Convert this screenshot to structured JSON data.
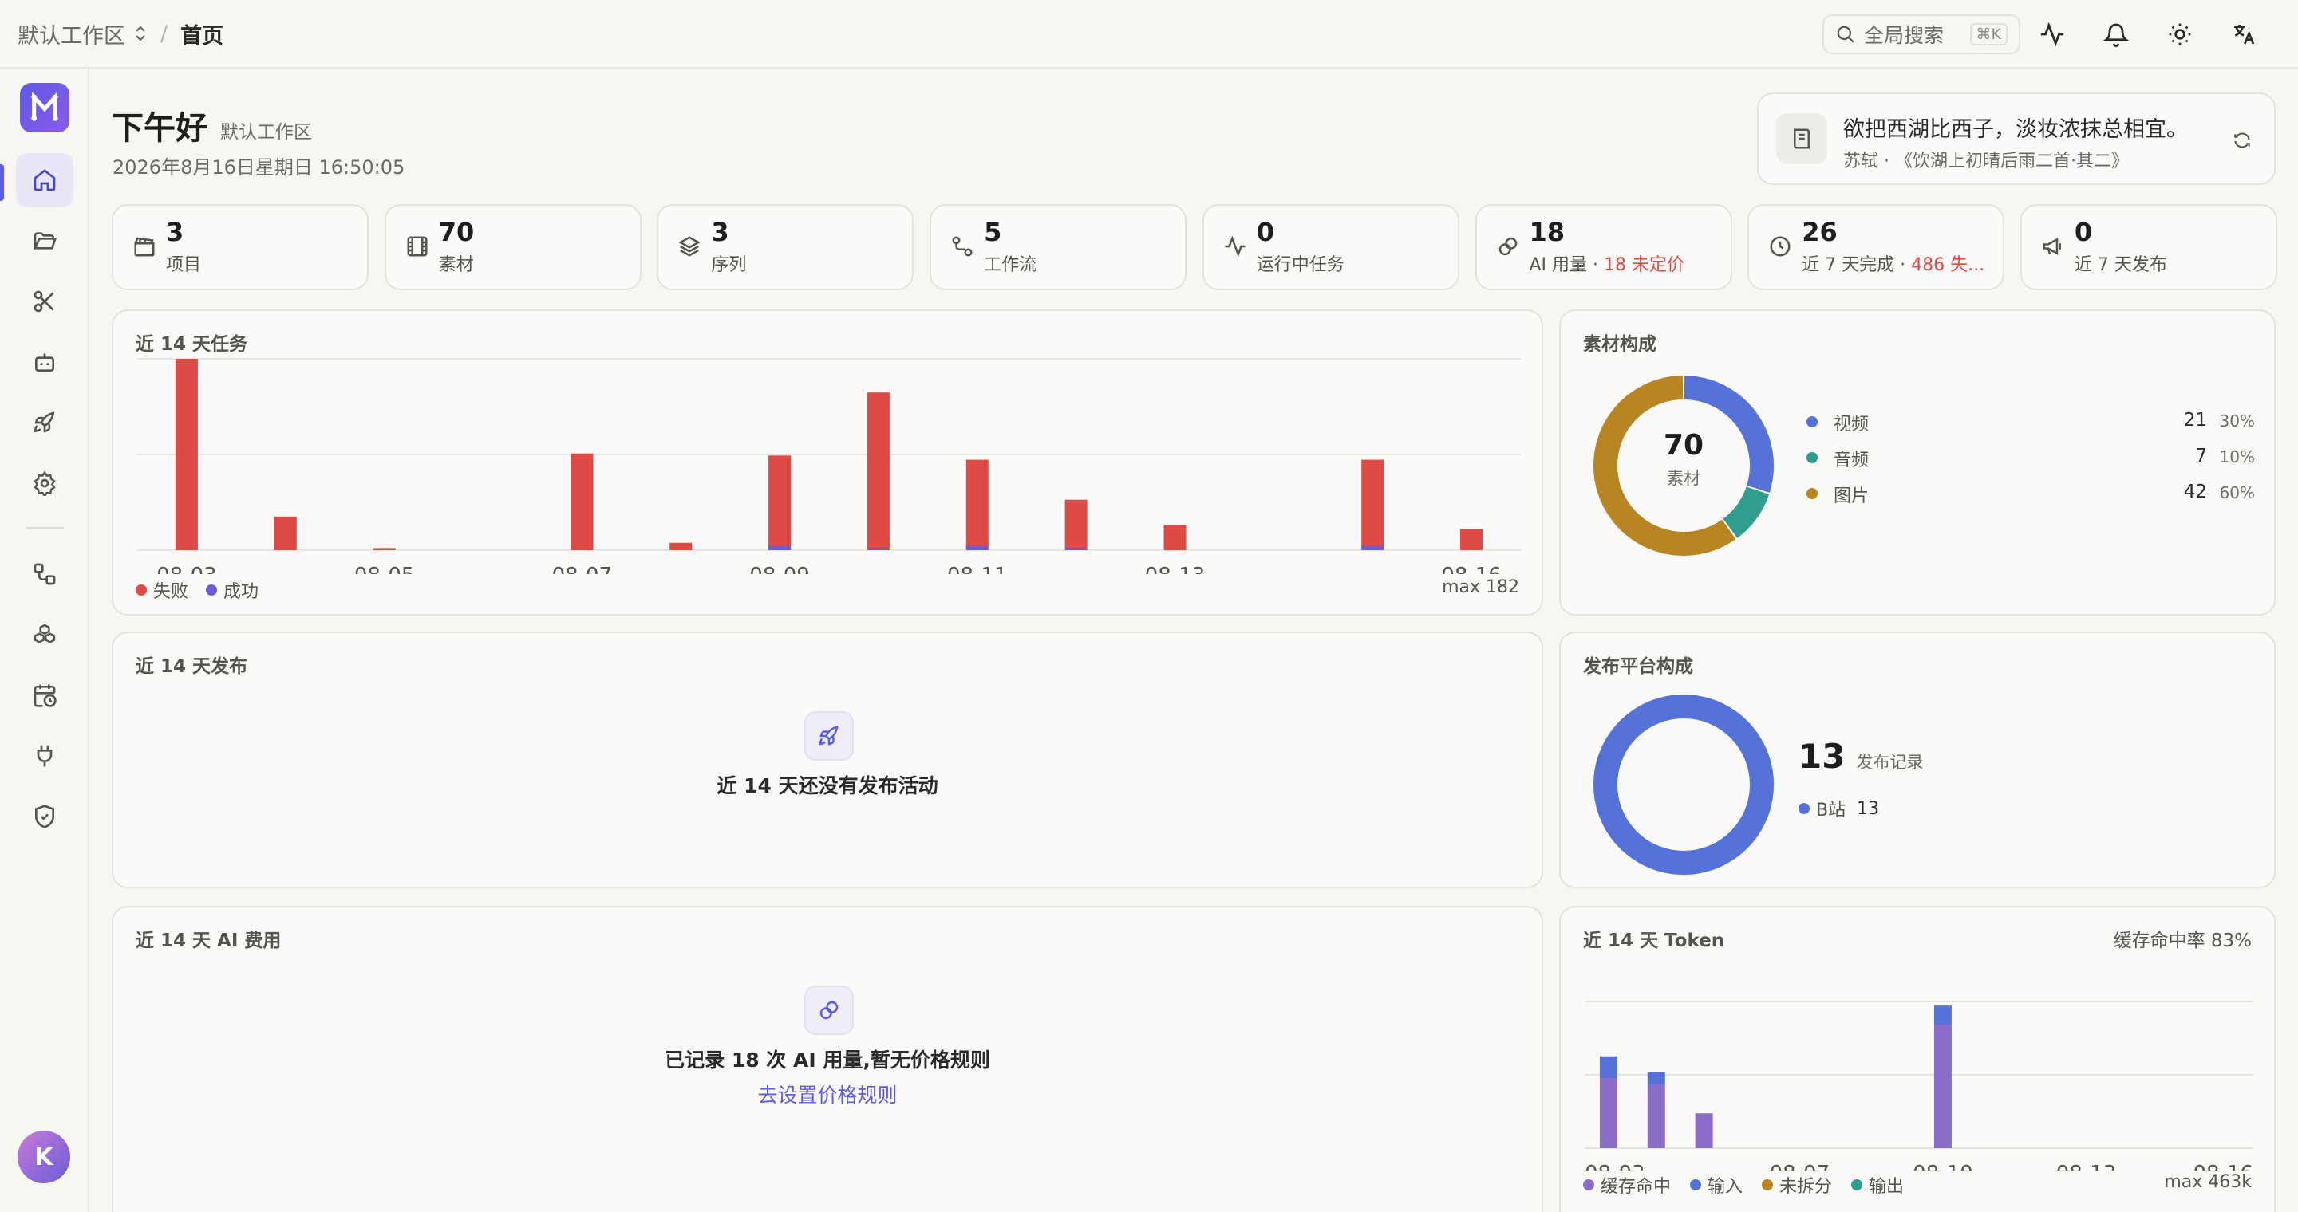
{
  "breadcrumb": {
    "workspace": "默认工作区",
    "current": "首页"
  },
  "topbar": {
    "search_label": "全局搜索",
    "search_kbd": "⌘K"
  },
  "user": {
    "avatar_initial": "K"
  },
  "header": {
    "greeting": "下午好",
    "workspace": "默认工作区",
    "datetime": "2026年8月16日星期日 16:50:05"
  },
  "quote": {
    "text": "欲把西湖比西子，淡妆浓抹总相宜。",
    "author": "苏轼 · 《饮湖上初晴后雨二首·其二》"
  },
  "stats": [
    {
      "value": "3",
      "label": "项目",
      "icon": "clapperboard-icon"
    },
    {
      "value": "70",
      "label": "素材",
      "icon": "film-icon"
    },
    {
      "value": "3",
      "label": "序列",
      "icon": "layers-icon"
    },
    {
      "value": "5",
      "label": "工作流",
      "icon": "workflow-icon"
    },
    {
      "value": "0",
      "label": "运行中任务",
      "icon": "activity-icon"
    },
    {
      "value": "18",
      "label": "AI 用量 · ",
      "label_red": "18 未定价",
      "icon": "ai-link-icon"
    },
    {
      "value": "26",
      "label": "近 7 天完成 · ",
      "label_red": "486 失...",
      "icon": "clock-icon"
    },
    {
      "value": "0",
      "label": "近 7 天发布",
      "icon": "megaphone-icon"
    }
  ],
  "tasks_chart": {
    "title": "近 14 天任务",
    "max_label": "max 182",
    "legend": [
      {
        "name": "失败",
        "color": "#e04a45"
      },
      {
        "name": "成功",
        "color": "#6b5cd9"
      }
    ]
  },
  "assets_chart": {
    "title": "素材构成",
    "center_value": "70",
    "center_label": "素材",
    "items": [
      {
        "name": "视频",
        "count": "21",
        "pct": "30%",
        "color": "#5572d9"
      },
      {
        "name": "音频",
        "count": "7",
        "pct": "10%",
        "color": "#2f9e8e"
      },
      {
        "name": "图片",
        "count": "42",
        "pct": "60%",
        "color": "#b98522"
      }
    ]
  },
  "publish_chart": {
    "title": "近 14 天发布",
    "empty": "近 14 天还没有发布活动"
  },
  "platform_chart": {
    "title": "发布平台构成",
    "total": "13",
    "total_label": "发布记录",
    "items": [
      {
        "name": "B站",
        "count": "13",
        "color": "#5572d9"
      }
    ]
  },
  "ai_cost": {
    "title": "近 14 天 AI 费用",
    "empty": "已记录 18 次 AI 用量,暂无价格规则",
    "link": "去设置价格规则"
  },
  "token_chart": {
    "title": "近 14 天 Token",
    "cache_rate": "缓存命中率 83%",
    "max_label": "max 463k",
    "legend": [
      {
        "name": "缓存命中",
        "color": "#8c6cc9"
      },
      {
        "name": "输入",
        "color": "#5572d9"
      },
      {
        "name": "未拆分",
        "color": "#b98522"
      },
      {
        "name": "输出",
        "color": "#2f9e8e"
      }
    ]
  },
  "chart_data": [
    {
      "type": "bar",
      "title": "近 14 天任务",
      "categories": [
        "08-03",
        "08-04",
        "08-05",
        "08-06",
        "08-07",
        "08-08",
        "08-09",
        "08-10",
        "08-11",
        "08-12",
        "08-13",
        "08-14",
        "08-15",
        "08-16"
      ],
      "tick_labels": [
        "08-03",
        "08-05",
        "08-07",
        "08-09",
        "08-11",
        "08-13",
        "08-16"
      ],
      "series": [
        {
          "name": "失败",
          "values": [
            182,
            32,
            2,
            0,
            92,
            7,
            90,
            150,
            86,
            48,
            24,
            0,
            86,
            20
          ]
        },
        {
          "name": "成功",
          "values": [
            0,
            0,
            0,
            0,
            0,
            0,
            4,
            2,
            4,
            2,
            0,
            0,
            4,
            0
          ]
        }
      ],
      "ylim": [
        0,
        182
      ]
    },
    {
      "type": "pie",
      "title": "素材构成",
      "categories": [
        "视频",
        "音频",
        "图片"
      ],
      "values": [
        21,
        7,
        42
      ]
    },
    {
      "type": "pie",
      "title": "发布平台构成",
      "categories": [
        "B站"
      ],
      "values": [
        13
      ]
    },
    {
      "type": "bar",
      "title": "近 14 天 Token",
      "categories": [
        "08-03",
        "08-04",
        "08-05",
        "08-06",
        "08-07",
        "08-08",
        "08-09",
        "08-10",
        "08-11",
        "08-12",
        "08-13",
        "08-14",
        "08-15",
        "08-16"
      ],
      "tick_labels": [
        "08-03",
        "08-07",
        "08-10",
        "08-13",
        "08-16"
      ],
      "series": [
        {
          "name": "缓存命中",
          "values": [
            220,
            200,
            110,
            0,
            0,
            0,
            0,
            0,
            0,
            0,
            0,
            0,
            0,
            0
          ]
        },
        {
          "name": "输入",
          "values": [
            70,
            40,
            0,
            0,
            0,
            0,
            0,
            0,
            0,
            0,
            0,
            0,
            0,
            0
          ]
        }
      ],
      "series_extra": {
        "index": 7,
        "cache": 390,
        "input": 60
      },
      "ylim": [
        0,
        463
      ]
    }
  ]
}
